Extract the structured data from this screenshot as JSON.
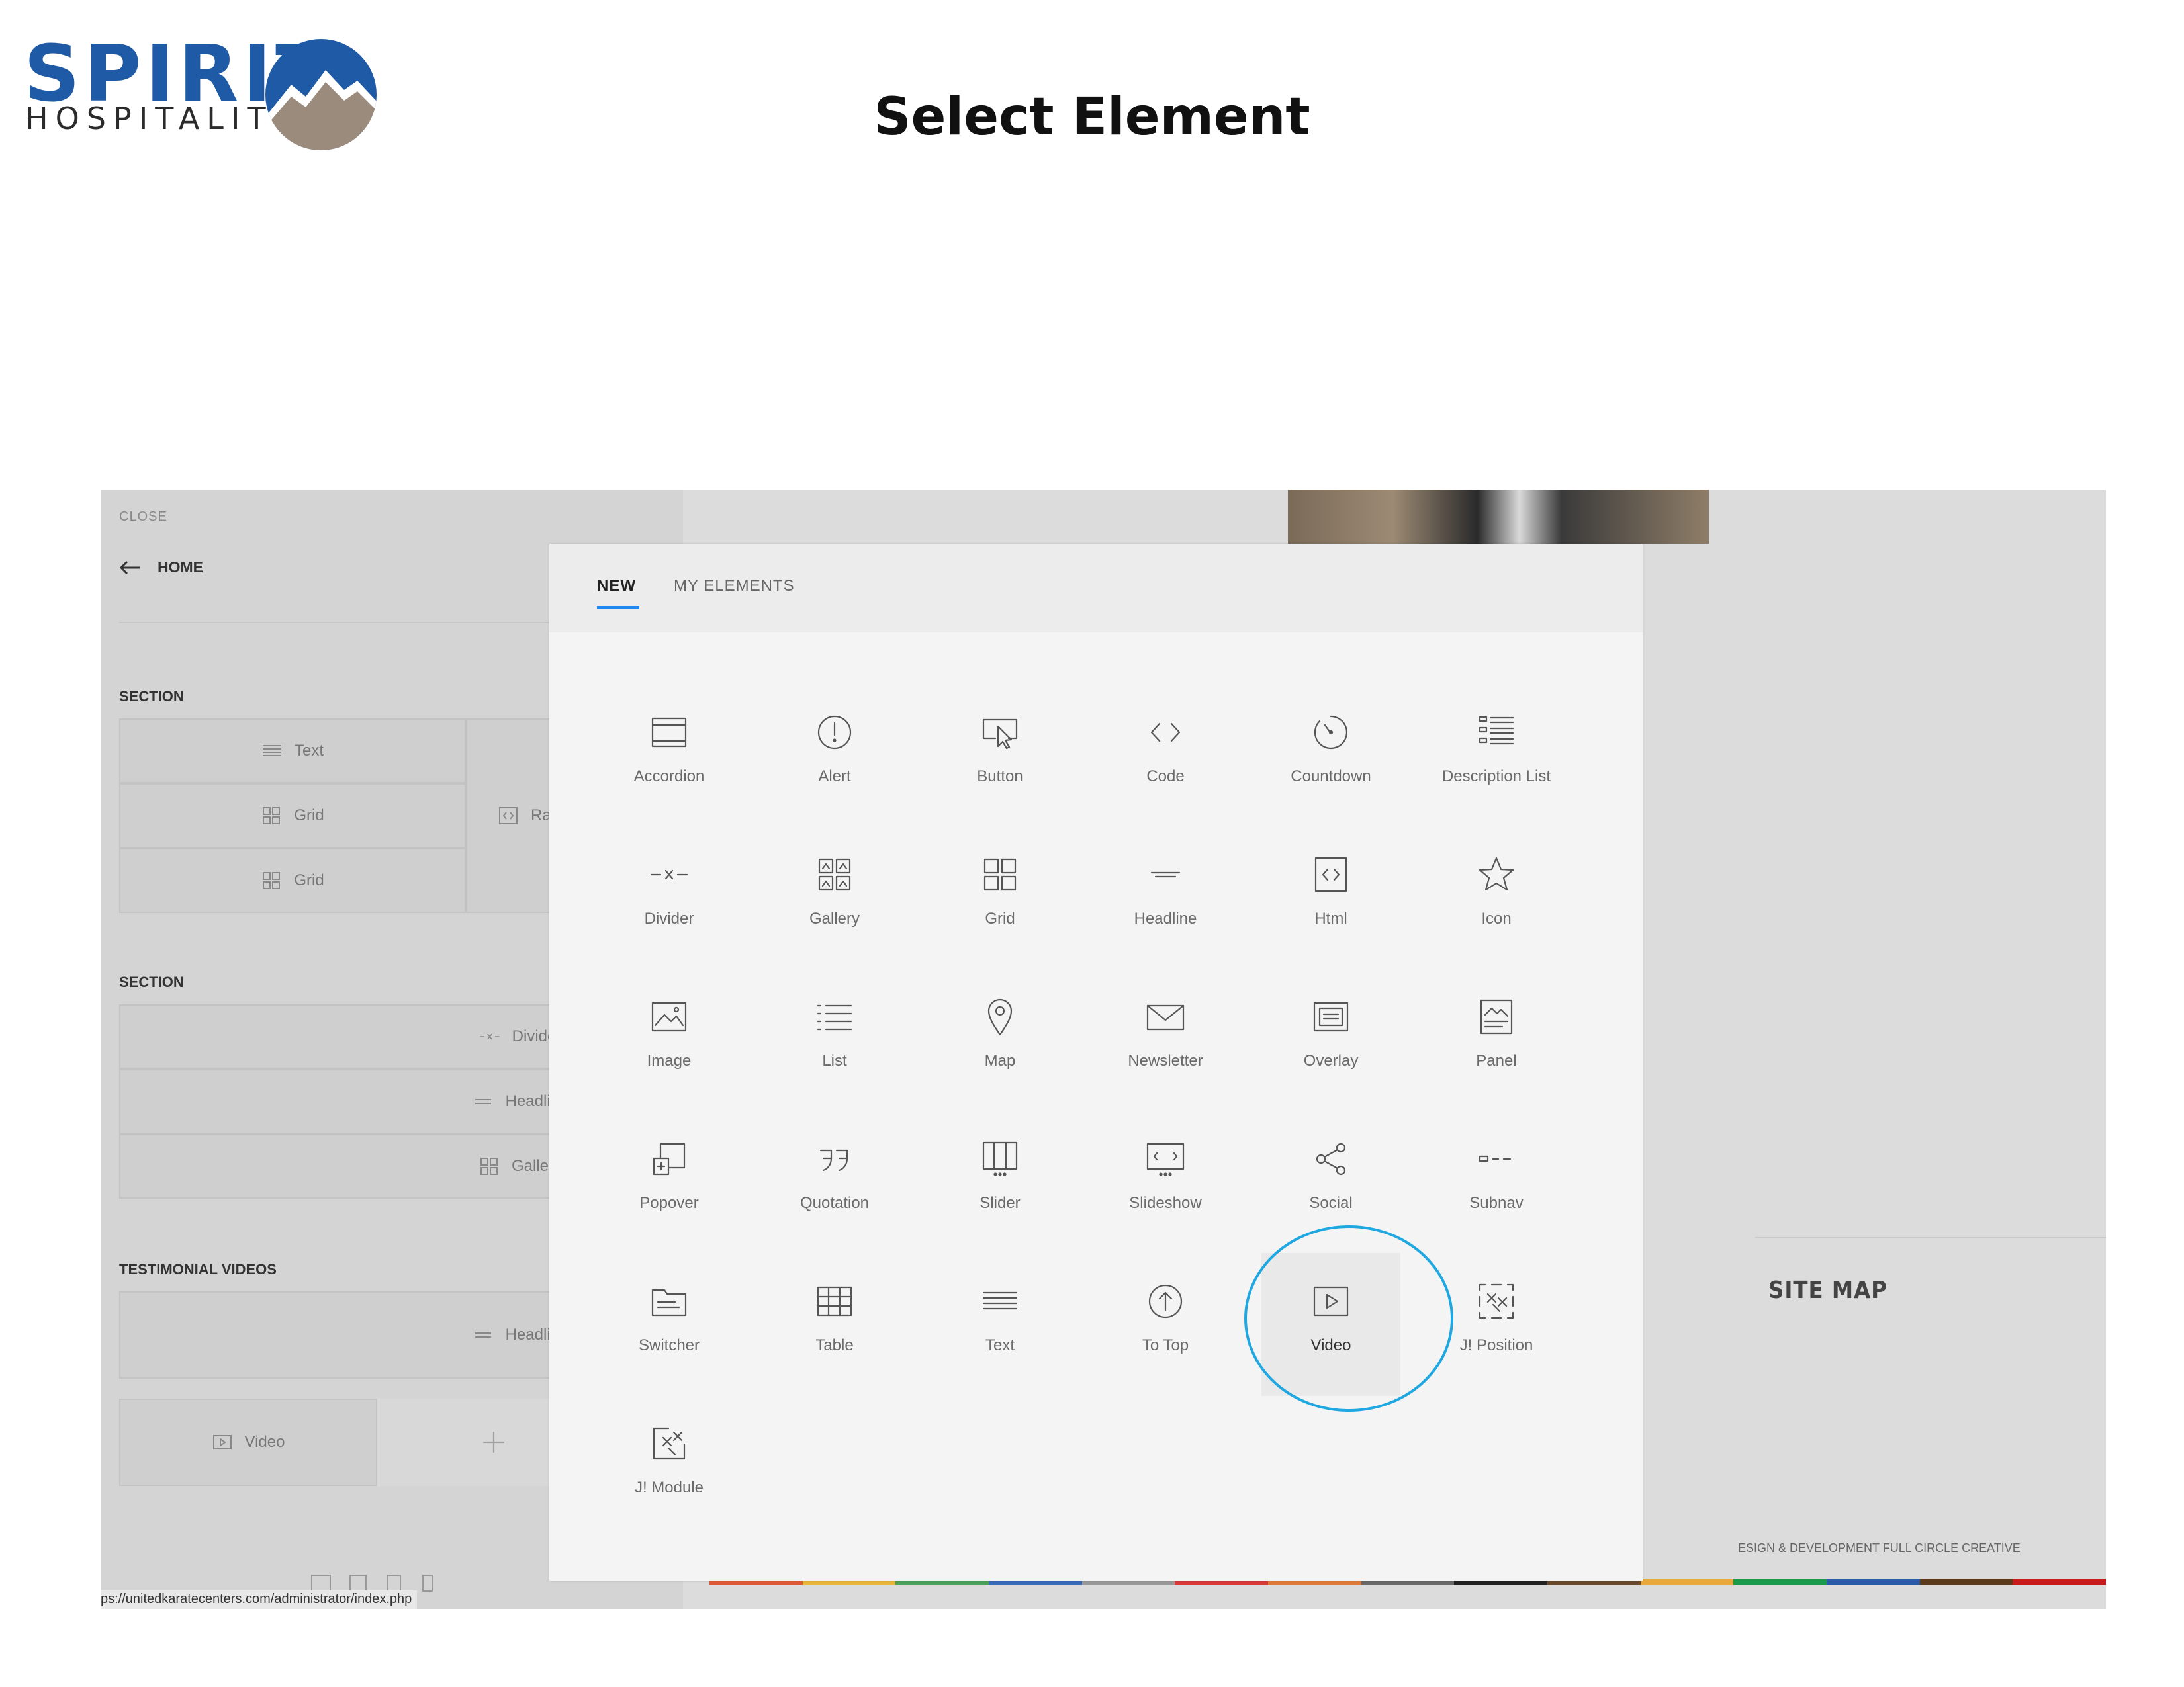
{
  "branding": {
    "logo_word": "SPIRIT",
    "logo_sub": "HOSPITALITY",
    "slide_title": "Select Element",
    "colors": {
      "blue": "#1f5aa6",
      "taupe": "#9a8b7c"
    }
  },
  "left_panel": {
    "close_label": "CLOSE",
    "home_label": "HOME",
    "sections": [
      {
        "title": "SECTION",
        "items": [
          "Text",
          "Grid",
          "Grid"
        ],
        "side_item": "Ra"
      },
      {
        "title": "SECTION",
        "items": [
          "Divider",
          "Headline",
          "Gallery"
        ]
      },
      {
        "title": "TESTIMONIAL VIDEOS",
        "items": [
          "Headline",
          "Video"
        ]
      }
    ],
    "status_url": "ps://unitedkaratecenters.com/administrator/index.php"
  },
  "background_page": {
    "site_map_label": "SITE MAP",
    "credit_prefix": "ESIGN & DEVELOPMENT ",
    "credit_link": "FULL CIRCLE CREATIVE"
  },
  "modal": {
    "tabs": [
      "NEW",
      "MY ELEMENTS"
    ],
    "active_tab": "NEW",
    "elements": [
      {
        "label": "Accordion",
        "icon": "accordion-icon"
      },
      {
        "label": "Alert",
        "icon": "alert-icon"
      },
      {
        "label": "Button",
        "icon": "button-icon"
      },
      {
        "label": "Code",
        "icon": "code-icon"
      },
      {
        "label": "Countdown",
        "icon": "countdown-icon"
      },
      {
        "label": "Description List",
        "icon": "description-list-icon"
      },
      {
        "label": "Divider",
        "icon": "divider-icon"
      },
      {
        "label": "Gallery",
        "icon": "gallery-icon"
      },
      {
        "label": "Grid",
        "icon": "grid-icon"
      },
      {
        "label": "Headline",
        "icon": "headline-icon"
      },
      {
        "label": "Html",
        "icon": "html-icon"
      },
      {
        "label": "Icon",
        "icon": "star-icon"
      },
      {
        "label": "Image",
        "icon": "image-icon"
      },
      {
        "label": "List",
        "icon": "list-icon"
      },
      {
        "label": "Map",
        "icon": "map-pin-icon"
      },
      {
        "label": "Newsletter",
        "icon": "envelope-icon"
      },
      {
        "label": "Overlay",
        "icon": "overlay-icon"
      },
      {
        "label": "Panel",
        "icon": "panel-icon"
      },
      {
        "label": "Popover",
        "icon": "popover-icon"
      },
      {
        "label": "Quotation",
        "icon": "quotation-icon"
      },
      {
        "label": "Slider",
        "icon": "slider-icon"
      },
      {
        "label": "Slideshow",
        "icon": "slideshow-icon"
      },
      {
        "label": "Social",
        "icon": "share-icon"
      },
      {
        "label": "Subnav",
        "icon": "subnav-icon"
      },
      {
        "label": "Switcher",
        "icon": "switcher-icon"
      },
      {
        "label": "Table",
        "icon": "table-icon"
      },
      {
        "label": "Text",
        "icon": "text-icon"
      },
      {
        "label": "To Top",
        "icon": "to-top-icon"
      },
      {
        "label": "Video",
        "icon": "video-icon",
        "highlighted": true
      },
      {
        "label": "J! Position",
        "icon": "joomla-position-icon"
      },
      {
        "label": "J! Module",
        "icon": "joomla-module-icon"
      }
    ]
  }
}
